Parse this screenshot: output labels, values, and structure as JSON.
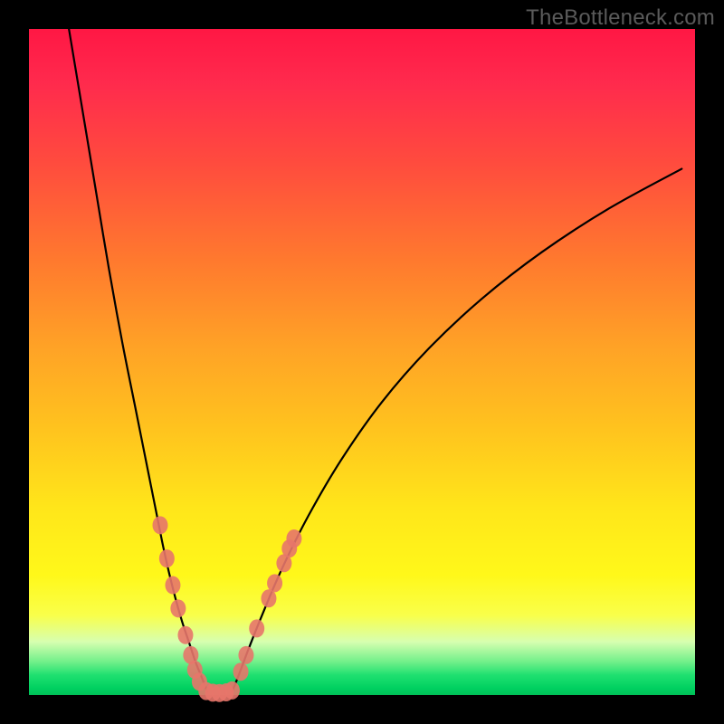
{
  "watermark": "TheBottleneck.com",
  "chart_data": {
    "type": "line",
    "title": "",
    "xlabel": "",
    "ylabel": "",
    "xlim": [
      0,
      100
    ],
    "ylim": [
      0,
      100
    ],
    "grid": false,
    "legend": false,
    "series": [
      {
        "name": "left-curve",
        "x": [
          6,
          8,
          10,
          12,
          14,
          16,
          18,
          20,
          21,
          22,
          23,
          24,
          25,
          26,
          26.8
        ],
        "y": [
          100,
          88,
          76,
          64,
          53,
          43,
          33,
          23,
          18.5,
          14.5,
          11,
          8,
          5,
          2.5,
          0.5
        ]
      },
      {
        "name": "right-curve",
        "x": [
          30.5,
          31.5,
          33,
          35,
          38,
          42,
          47,
          53,
          60,
          68,
          77,
          87,
          98
        ],
        "y": [
          0.5,
          3,
          7,
          12,
          19,
          27,
          35.5,
          44,
          52,
          59.5,
          66.5,
          73,
          79
        ]
      }
    ],
    "markers": [
      {
        "name": "left-dots",
        "color": "#e7766a",
        "points": [
          {
            "x": 19.7,
            "y": 25.5
          },
          {
            "x": 20.7,
            "y": 20.5
          },
          {
            "x": 21.6,
            "y": 16.5
          },
          {
            "x": 22.4,
            "y": 13.0
          },
          {
            "x": 23.5,
            "y": 9.0
          },
          {
            "x": 24.3,
            "y": 6.0
          },
          {
            "x": 24.9,
            "y": 3.8
          },
          {
            "x": 25.6,
            "y": 2.0
          }
        ]
      },
      {
        "name": "right-dots",
        "color": "#e7766a",
        "points": [
          {
            "x": 31.8,
            "y": 3.5
          },
          {
            "x": 32.6,
            "y": 6.0
          },
          {
            "x": 34.2,
            "y": 10.0
          },
          {
            "x": 36.0,
            "y": 14.5
          },
          {
            "x": 36.9,
            "y": 16.8
          },
          {
            "x": 38.3,
            "y": 19.8
          },
          {
            "x": 39.1,
            "y": 22.0
          },
          {
            "x": 39.8,
            "y": 23.5
          }
        ]
      },
      {
        "name": "bottom-dots",
        "color": "#e7766a",
        "points": [
          {
            "x": 26.6,
            "y": 0.6
          },
          {
            "x": 27.6,
            "y": 0.35
          },
          {
            "x": 28.6,
            "y": 0.3
          },
          {
            "x": 29.6,
            "y": 0.4
          },
          {
            "x": 30.5,
            "y": 0.7
          }
        ]
      }
    ]
  }
}
